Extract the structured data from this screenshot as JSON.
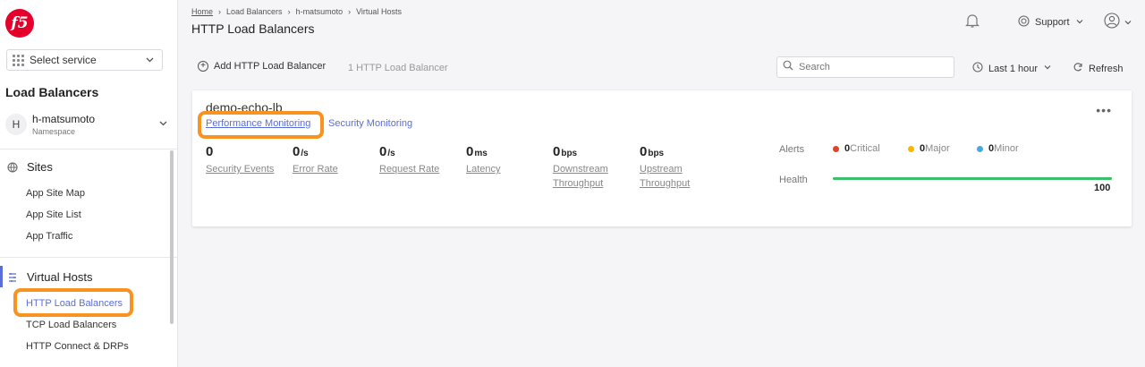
{
  "brand": {
    "logo_text": "f5",
    "color": "#e4002b"
  },
  "sidebar": {
    "service_select": {
      "label": "Select service"
    },
    "section_title": "Load Balancers",
    "namespace": {
      "avatar": "H",
      "name": "h-matsumoto",
      "sub": "Namespace"
    },
    "groups": [
      {
        "label": "Sites",
        "icon": "globe-icon",
        "items": [
          "App Site Map",
          "App Site List",
          "App Traffic"
        ]
      },
      {
        "label": "Virtual Hosts",
        "icon": "virtual-hosts-icon",
        "items": [
          "HTTP Load Balancers",
          "TCP Load Balancers",
          "HTTP Connect & DRPs"
        ]
      }
    ],
    "active_item": "HTTP Load Balancers"
  },
  "header": {
    "breadcrumb": [
      "Home",
      "Load Balancers",
      "h-matsumoto",
      "Virtual Hosts"
    ],
    "title": "HTTP Load Balancers",
    "support_label": "Support"
  },
  "toolbar": {
    "add_label": "Add HTTP Load Balancer",
    "count_label": "1 HTTP Load Balancer",
    "search_placeholder": "Search",
    "time_range": "Last 1 hour",
    "refresh_label": "Refresh"
  },
  "card": {
    "name": "demo-echo-lb",
    "tabs": [
      "Performance Monitoring",
      "Security Monitoring"
    ],
    "active_tab": "Performance Monitoring",
    "metrics": [
      {
        "value": "0",
        "unit": "",
        "label": "Security Events"
      },
      {
        "value": "0",
        "unit": "/s",
        "label": "Error Rate"
      },
      {
        "value": "0",
        "unit": "/s",
        "label": "Request Rate"
      },
      {
        "value": "0",
        "unit": "ms",
        "label": "Latency"
      },
      {
        "value": "0",
        "unit": "bps",
        "label": "Downstream Throughput"
      },
      {
        "value": "0",
        "unit": "bps",
        "label": "Upstream Throughput"
      }
    ],
    "alerts_label": "Alerts",
    "alerts": [
      {
        "count": "0",
        "label": "Critical",
        "color": "#e0422c"
      },
      {
        "count": "0",
        "label": "Major",
        "color": "#f5b800"
      },
      {
        "count": "0",
        "label": "Minor",
        "color": "#4aa8e0"
      }
    ],
    "health_label": "Health",
    "health_value": "100",
    "health_color": "#3bbf6b"
  },
  "highlight_color": "#f7931e"
}
